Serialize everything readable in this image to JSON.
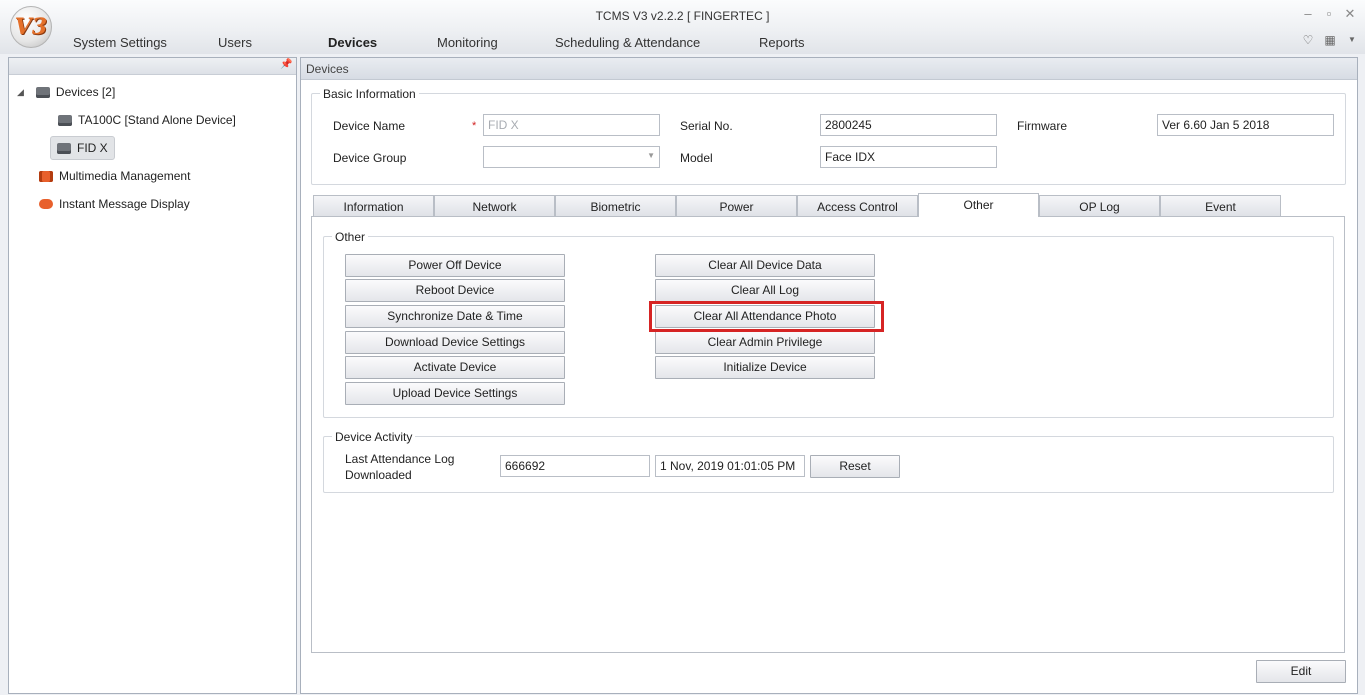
{
  "window": {
    "title": "TCMS V3 v2.2.2 [ FINGERTEC ]",
    "logo_text": "V3"
  },
  "menu": {
    "items": [
      "System Settings",
      "Users",
      "Devices",
      "Monitoring",
      "Scheduling & Attendance",
      "Reports"
    ],
    "active": "Devices"
  },
  "tree": {
    "root_label": "Devices [2]",
    "devices": [
      "TA100C [Stand Alone Device]",
      "FID X"
    ],
    "selected": "FID X",
    "other_items": [
      "Multimedia Management",
      "Instant Message Display"
    ]
  },
  "panel_header": "Devices",
  "basic_info": {
    "group_label": "Basic Information",
    "device_name_label": "Device Name",
    "device_name_value": "FID X",
    "required_marker": "*",
    "serial_label": "Serial No.",
    "serial_value": "2800245",
    "firmware_label": "Firmware",
    "firmware_value": "Ver 6.60 Jan  5 2018",
    "device_group_label": "Device Group",
    "device_group_value": "",
    "model_label": "Model",
    "model_value": "Face IDX"
  },
  "tabs": [
    "Information",
    "Network",
    "Biometric",
    "Power",
    "Access Control",
    "Other",
    "OP Log",
    "Event"
  ],
  "active_tab": "Other",
  "other_group": {
    "label": "Other",
    "left_buttons": [
      "Power Off Device",
      "Reboot Device",
      "Synchronize Date & Time",
      "Download Device Settings",
      "Activate Device",
      "Upload Device Settings"
    ],
    "right_buttons": [
      "Clear All Device Data",
      "Clear All Log",
      "Clear All Attendance Photo",
      "Clear Admin Privilege",
      "Initialize Device"
    ],
    "highlighted_button": "Clear All Attendance Photo",
    "highlight_color": "#d62424"
  },
  "activity": {
    "group_label": "Device Activity",
    "label_line1": "Last Attendance Log",
    "label_line2": "Downloaded",
    "log_count": "666692",
    "log_time": "1 Nov, 2019 01:01:05 PM",
    "reset_label": "Reset"
  },
  "edit_label": "Edit"
}
